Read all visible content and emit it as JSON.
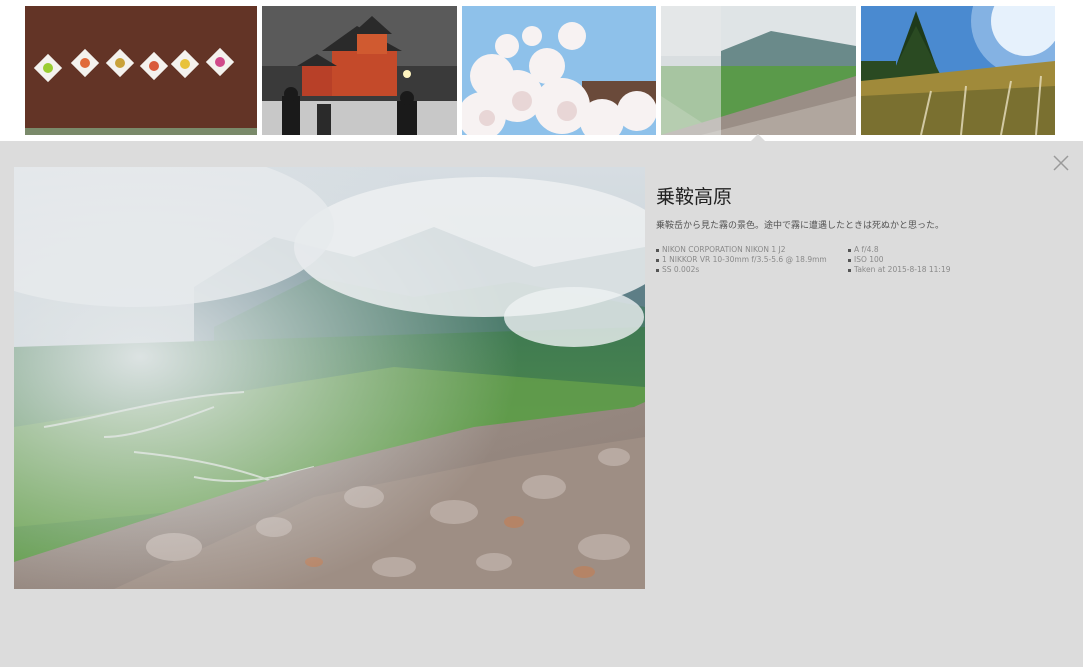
{
  "thumbnails": [
    {
      "icon": "sweets-on-brown-cloth-photo"
    },
    {
      "icon": "red-shrine-in-snow-photo"
    },
    {
      "icon": "cherry-blossoms-photo"
    },
    {
      "icon": "misty-mountain-valley-photo",
      "selected": true
    },
    {
      "icon": "pampas-grass-sunlight-photo"
    }
  ],
  "detail": {
    "title": "乗鞍高原",
    "description": "乗鞍岳から見た霧の景色。途中で霧に遭遇したときは死ぬかと思った。",
    "exif_left": [
      "NIKON CORPORATION NIKON 1 J2",
      "1 NIKKOR VR 10-30mm f/3.5-5.6 @ 18.9mm",
      "SS 0.002s"
    ],
    "exif_right": [
      "A f/4.8",
      "ISO 100",
      "Taken at 2015-8-18 11:19"
    ]
  },
  "controls": {
    "close_icon": "close-icon"
  },
  "colors": {
    "panel_bg": "#dcdcdc",
    "page_bg": "#ffffff"
  }
}
